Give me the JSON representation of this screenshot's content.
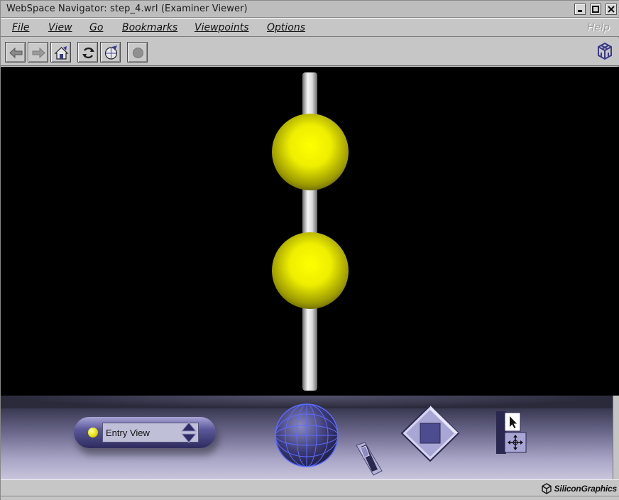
{
  "window": {
    "title": "WebSpace Navigator: step_4.wrl (Examiner Viewer)",
    "controls": [
      "minimize-icon",
      "maximize-icon",
      "close-icon"
    ]
  },
  "menubar": {
    "items": [
      {
        "label": "File",
        "mnemonic": "F"
      },
      {
        "label": "View",
        "mnemonic": "V"
      },
      {
        "label": "Go",
        "mnemonic": "G"
      },
      {
        "label": "Bookmarks",
        "mnemonic": "B"
      },
      {
        "label": "Viewpoints",
        "mnemonic": "V"
      },
      {
        "label": "Options",
        "mnemonic": "O"
      }
    ],
    "help": "Help"
  },
  "toolbar": {
    "buttons": [
      {
        "icon": "back-arrow-icon"
      },
      {
        "icon": "forward-arrow-icon"
      },
      {
        "icon": "home-icon"
      },
      {
        "icon": "reload-icon"
      },
      {
        "icon": "open-icon"
      },
      {
        "icon": "stop-icon"
      }
    ],
    "brand_icon": "sgi-cube-icon"
  },
  "scene": {
    "background": "#000000",
    "objects": [
      "vertical-cylinder",
      "upper-yellow-sphere",
      "lower-yellow-sphere"
    ],
    "sphere_color": "#e6e600",
    "cylinder_color": "#d0d0d0"
  },
  "dashboard": {
    "viewpoint_label": "Entry View",
    "controls": [
      "viewpoint-selector",
      "rotate-globe",
      "zoom-slider",
      "pan-diamond",
      "select-mode",
      "examine-mode"
    ]
  },
  "status": {
    "brand": "SiliconGraphics"
  }
}
